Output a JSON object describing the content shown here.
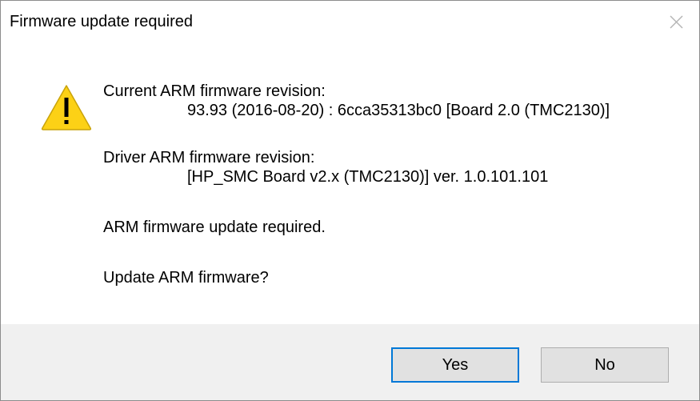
{
  "window": {
    "title": "Firmware update required",
    "close_icon": "close-icon"
  },
  "message": {
    "icon": "warning-icon",
    "current_label": "Current ARM firmware revision:",
    "current_value": "93.93 (2016-08-20) : 6cca35313bc0 [Board 2.0 (TMC2130)]",
    "driver_label": "Driver ARM firmware revision:",
    "driver_value": "[HP_SMC Board v2.x (TMC2130)] ver. 1.0.101.101",
    "required_text": "ARM firmware update required.",
    "question_text": "Update ARM firmware?"
  },
  "buttons": {
    "yes_label": "Yes",
    "no_label": "No"
  },
  "colors": {
    "focus_border": "#0078d7",
    "footer_bg": "#f0f0f0",
    "button_bg": "#e1e1e1",
    "warning_fill": "#fcd116"
  }
}
